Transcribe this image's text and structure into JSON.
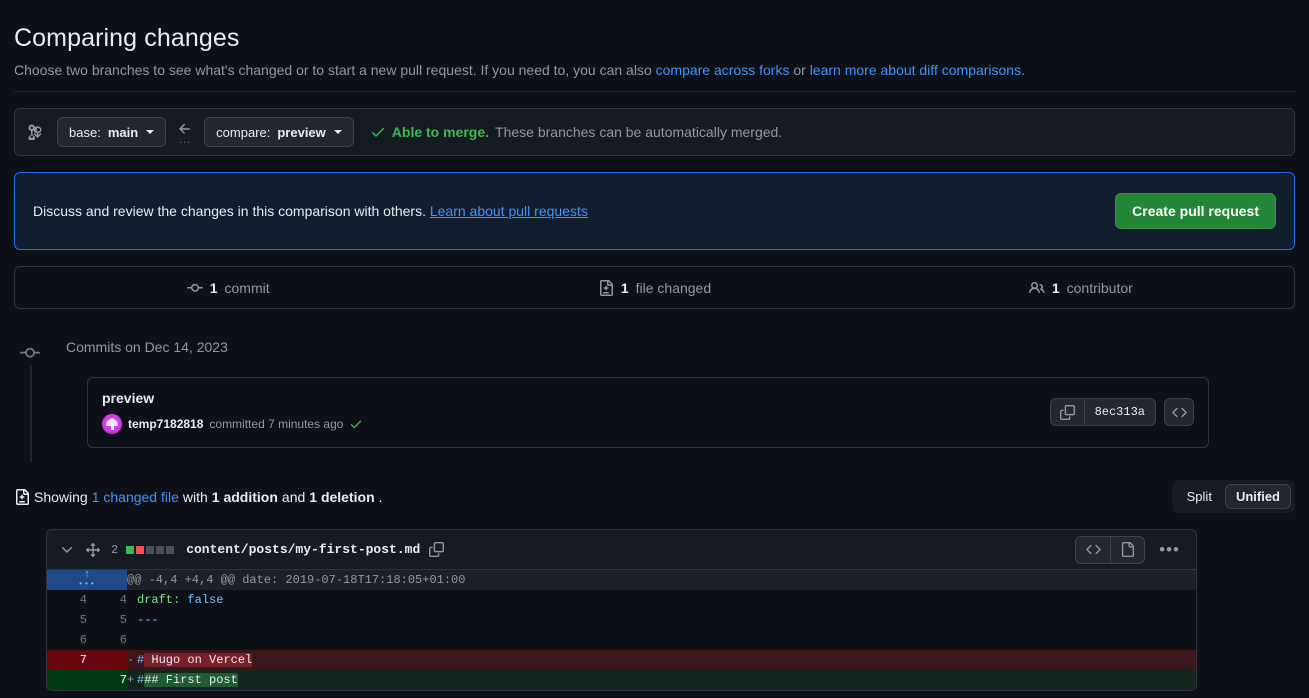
{
  "page": {
    "title": "Comparing changes",
    "subtitle_before": "Choose two branches to see what's changed or to start a new pull request. If you need to, you can also ",
    "subtitle_link1": "compare across forks",
    "subtitle_mid": " or ",
    "subtitle_link2": "learn more about diff comparisons",
    "subtitle_end": "."
  },
  "branch_bar": {
    "compare_icon": "git-compare-icon",
    "base_label_prefix": "base:",
    "base_branch": "main",
    "arrow_icon": "arrow-left-icon",
    "arrow_dots": "...",
    "compare_label_prefix": "compare:",
    "compare_branch": "preview",
    "status_icon": "check-icon",
    "status_strong": "Able to merge.",
    "status_text": " These branches can be automatically merged."
  },
  "pr_banner": {
    "text": "Discuss and review the changes in this comparison with others.",
    "link": "Learn about pull requests",
    "button": "Create pull request",
    "button_color": "#238636",
    "border_color": "#1f6feb",
    "background_color": "#121d2f"
  },
  "stats": [
    {
      "icon": "commit-icon",
      "count": "1",
      "label": "commit"
    },
    {
      "icon": "file-diff-icon",
      "count": "1",
      "label": "file changed"
    },
    {
      "icon": "people-icon",
      "count": "1",
      "label": "contributor"
    }
  ],
  "commits": {
    "timeline_icon": "commit-icon",
    "heading": "Commits on Dec 14, 2023",
    "card": {
      "message": "preview",
      "avatar": "user-avatar",
      "author": "temp7182818",
      "meta_text": "committed 7 minutes ago",
      "verified_icon": "check-icon",
      "copy_icon": "copy-icon",
      "sha": "8ec313a",
      "code_icon": "code-icon"
    }
  },
  "showing": {
    "icon": "file-diff-icon",
    "prefix": "Showing ",
    "changed_file_link": "1 changed file",
    "with": " with ",
    "additions": "1 addition",
    "and": " and ",
    "deletions": "1 deletion",
    "period": ".",
    "view_options": [
      {
        "label": "Split",
        "active": false
      },
      {
        "label": "Unified",
        "active": true
      }
    ]
  },
  "diff": {
    "collapse_icon": "chevron-down-icon",
    "move_icon": "diff-move-icon",
    "change_count": "2",
    "diffstat": [
      "#3fb950",
      "#f85149",
      "#484f58",
      "#484f58",
      "#484f58"
    ],
    "filename": "content/posts/my-first-post.md",
    "copy_icon": "copy-icon",
    "code_icon": "code-icon",
    "file_icon": "file-icon",
    "kebab_icon": "kebab-horizontal-icon",
    "rows": [
      {
        "type": "hunk",
        "expand_icon": "expand-up-icon",
        "old_ln": "",
        "new_ln": "",
        "text": "@@ -4,4 +4,4 @@ date: 2019-07-18T17:18:05+01:00"
      },
      {
        "type": "context",
        "old_ln": "4",
        "new_ln": "4",
        "sign": " ",
        "key": "draft:",
        "value": " false"
      },
      {
        "type": "context",
        "old_ln": "5",
        "new_ln": "5",
        "sign": " ",
        "value": "---"
      },
      {
        "type": "context",
        "old_ln": "6",
        "new_ln": "6",
        "sign": " ",
        "value": ""
      },
      {
        "type": "deletion",
        "old_ln": "7",
        "new_ln": "",
        "sign": "-",
        "hash": "#",
        "highlight": " Hugo on Vercel"
      },
      {
        "type": "addition",
        "old_ln": "",
        "new_ln": "7",
        "sign": "+",
        "hash": "#",
        "highlight": "## First post"
      }
    ]
  }
}
